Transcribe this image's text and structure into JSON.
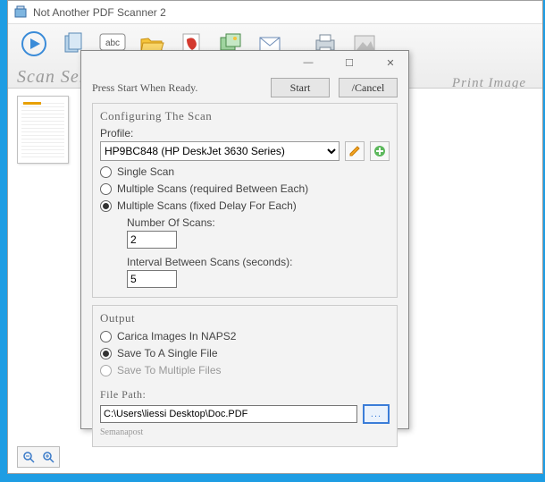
{
  "app": {
    "title": "Not Another PDF Scanner 2"
  },
  "toolbar": {
    "scan_caption": "Scan Serial Scan",
    "print_caption": "Print Image"
  },
  "dialog": {
    "instruction": "Press Start When Ready.",
    "start_label": "Start",
    "cancel_label": "/Cancel",
    "config": {
      "title": "Configuring The Scan",
      "profile_label": "Profile:",
      "profile_value": "HP9BC848 (HP DeskJet 3630 Series)",
      "single_scan": "Single Scan",
      "multi_required": "Multiple Scans (required Between Each)",
      "multi_fixed": "Multiple Scans (fixed Delay For Each)",
      "num_scans_label": "Number Of Scans:",
      "num_scans_value": "2",
      "interval_label": "Interval Between Scans (seconds):",
      "interval_value": "5"
    },
    "output": {
      "title": "Output",
      "carica": "Carica Images In NAPS2",
      "save_single": "Save To A Single File",
      "save_multi": "Save To Multiple Files",
      "file_path_label": "File Path:",
      "file_path_value": "C:\\Users\\liessi Desktop\\Doc.PDF",
      "browse": "...",
      "footnote": "Semanapost"
    }
  }
}
